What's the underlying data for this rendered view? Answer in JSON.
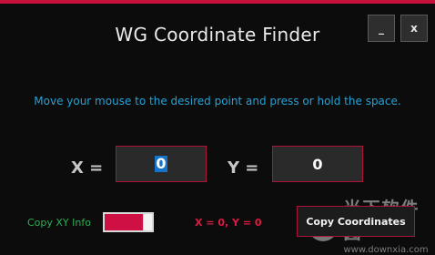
{
  "window": {
    "title": "WG Coordinate Finder",
    "minimize_label": "_",
    "close_label": "x"
  },
  "instruction": "Move your mouse to the desired point and press or hold the space.",
  "coordinates": {
    "x_label": "X =",
    "x_value": "0",
    "y_label": "Y =",
    "y_value": "0"
  },
  "footer": {
    "copy_info_label": "Copy XY Info",
    "copy_info_toggle_on": true,
    "status_text": "X = 0, Y = 0",
    "copy_button_label": "Copy Coordinates"
  },
  "watermark": {
    "text": "当下软件园",
    "url": "www.downxia.com"
  },
  "colors": {
    "accent": "#c8123e",
    "instruction_text": "#26a2d6",
    "copy_info_text": "#2fae55",
    "status_text": "#e01a41"
  }
}
